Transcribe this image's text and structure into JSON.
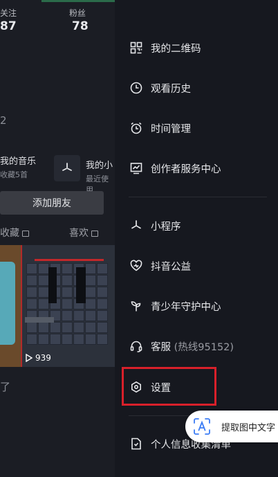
{
  "background_profile": {
    "stats": [
      {
        "label": "关注",
        "value": "87"
      },
      {
        "label": "粉丝",
        "value": "78"
      }
    ],
    "partial_number": "2",
    "music_card": {
      "title": "我的音乐",
      "subtitle": "收藏5首"
    },
    "miniapp_card": {
      "title": "我的小",
      "subtitle": "最近使用"
    },
    "add_friend_button": "添加朋友",
    "tabs": [
      {
        "label": "收藏"
      },
      {
        "label": "喜欢"
      }
    ],
    "video_play_count": "939",
    "bottom_partial_text": "了"
  },
  "drawer": {
    "group1": [
      {
        "label": "我的二维码",
        "icon": "qrcode-icon"
      },
      {
        "label": "观看历史",
        "icon": "clock-icon"
      },
      {
        "label": "时间管理",
        "icon": "alarm-clock-icon"
      },
      {
        "label": "创作者服务中心",
        "icon": "chart-monitor-icon"
      }
    ],
    "group2": [
      {
        "label": "小程序",
        "icon": "miniapp-asterisk-icon"
      },
      {
        "label": "抖音公益",
        "icon": "charity-heart-icon"
      },
      {
        "label": "青少年守护中心",
        "icon": "sprout-icon"
      },
      {
        "label": "客服",
        "sub": "(热线95152)",
        "icon": "headset-icon"
      },
      {
        "label": "设置",
        "icon": "settings-hexagon-icon"
      }
    ],
    "group3": [
      {
        "label": "个人信息收集清单",
        "icon": "document-icon"
      }
    ]
  },
  "ocr_button": {
    "label": "提取图中文字",
    "icon": "text-recognition-icon"
  },
  "colors": {
    "highlight": "#d8202a",
    "drawer_bg": "#16181f"
  }
}
